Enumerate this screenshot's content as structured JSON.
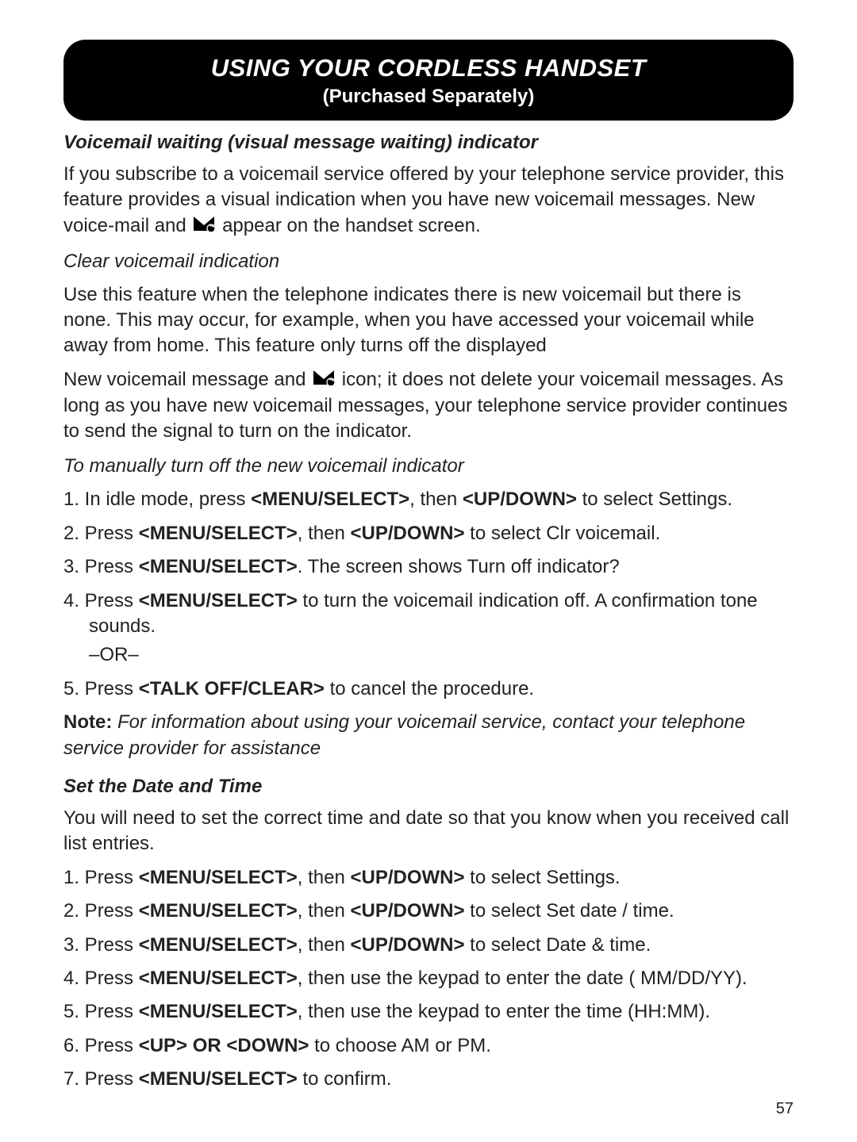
{
  "header": {
    "title": "USING YOUR CORDLESS HANDSET",
    "subtitle": "(Purchased Separately)"
  },
  "voicemail": {
    "heading": "Voicemail waiting (visual message waiting) indicator",
    "para1_a": "If you subscribe to a voicemail service offered by your telephone service provider, this feature provides a visual indication when you have new voicemail messages. New voice-mail and ",
    "para1_b": " appear on the handset screen.",
    "clear_head": "Clear voicemail indication",
    "clear_para": "Use this feature when the telephone indicates there is new voicemail but there is none. This may occur, for example, when you have accessed your voicemail while away from home. This feature only turns off the displayed",
    "clear_para2_a": "New voicemail message and ",
    "clear_para2_b": " icon; it does not delete your voicemail messages. As long as you have new voicemail messages, your telephone service provider continues to send the signal to turn on the indicator.",
    "manual_head": "To manually turn off the new voicemail indicator",
    "steps": {
      "s1_a": "1.  In idle mode, press ",
      "s1_b": "<MENU/SELECT>",
      "s1_c": ", then ",
      "s1_d": "<UP/DOWN>",
      "s1_e": " to select Settings.",
      "s2_a": "2.  Press ",
      "s2_b": "<MENU/SELECT>",
      "s2_c": ", then ",
      "s2_d": "<UP/DOWN>",
      "s2_e": " to select Clr voicemail.",
      "s3_a": "3.  Press ",
      "s3_b": "<MENU/SELECT>",
      "s3_c": ".  The screen shows Turn off indicator?",
      "s4_a": "4.  Press ",
      "s4_b": "<MENU/SELECT>",
      "s4_c": " to turn the voicemail indication off. A confirmation tone sounds.",
      "s4_or": "–OR–",
      "s5_a": "5.  Press ",
      "s5_b": "<TALK OFF/CLEAR>",
      "s5_c": " to cancel the procedure."
    },
    "note_label": "Note:",
    "note_body": " For information about using your voicemail service, contact your telephone service provider for assistance"
  },
  "datetime": {
    "heading": "Set the Date and Time",
    "para": "You will need to set the correct time and date so that you know when you received call list entries.",
    "steps": {
      "d1_a": "1.  Press ",
      "d1_b": "<MENU/SELECT>",
      "d1_c": ", then ",
      "d1_d": "<UP/DOWN>",
      "d1_e": " to select Settings.",
      "d2_a": "2.  Press ",
      "d2_b": "<MENU/SELECT>",
      "d2_c": ", then ",
      "d2_d": "<UP/DOWN>",
      "d2_e": " to select Set date / time.",
      "d3_a": "3.  Press ",
      "d3_b": "<MENU/SELECT>",
      "d3_c": ", then ",
      "d3_d": "<UP/DOWN>",
      "d3_e": " to select Date & time.",
      "d4_a": "4.  Press ",
      "d4_b": "<MENU/SELECT>",
      "d4_c": ", then use the keypad to enter the date ( MM/DD/YY).",
      "d5_a": "5.  Press ",
      "d5_b": "<MENU/SELECT>",
      "d5_c": ", then use the keypad to enter the time (HH:MM).",
      "d6_a": "6.  Press ",
      "d6_b": "<UP> OR <DOWN>",
      "d6_c": " to choose AM or PM.",
      "d7_a": "7.  Press ",
      "d7_b": "<MENU/SELECT>",
      "d7_c": " to confirm."
    }
  },
  "page": "57"
}
